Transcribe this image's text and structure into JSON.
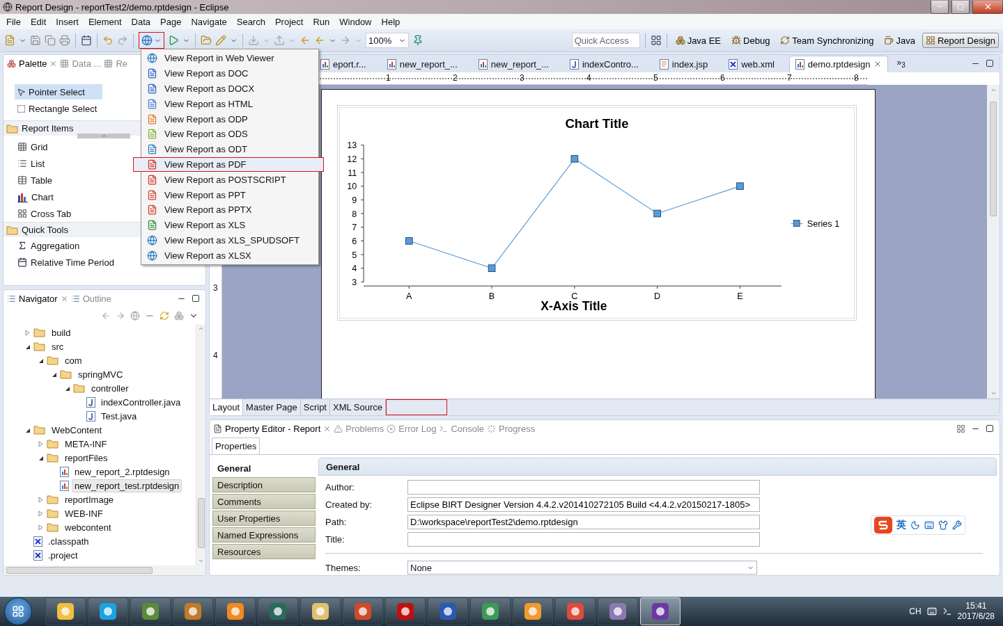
{
  "window": {
    "title": "Report Design - reportTest2/demo.rptdesign - Eclipse"
  },
  "menu_bar": [
    "File",
    "Edit",
    "Insert",
    "Element",
    "Data",
    "Page",
    "Navigate",
    "Search",
    "Project",
    "Run",
    "Window",
    "Help"
  ],
  "toolbar": {
    "run_report_expanded": true,
    "zoom": "100%",
    "quick_access": {
      "placeholder": "Quick Access"
    }
  },
  "perspectives": [
    {
      "label": "Java EE",
      "selected": false
    },
    {
      "label": "Debug",
      "selected": false
    },
    {
      "label": "Team Synchronizing",
      "selected": false
    },
    {
      "label": "Java",
      "selected": false
    },
    {
      "label": "Report Design",
      "selected": true
    }
  ],
  "run_menu": [
    {
      "label": "View Report in Web Viewer",
      "selected": false
    },
    {
      "label": "View Report as DOC",
      "selected": false
    },
    {
      "label": "View Report as DOCX",
      "selected": false
    },
    {
      "label": "View Report as HTML",
      "selected": false
    },
    {
      "label": "View Report as ODP",
      "selected": false
    },
    {
      "label": "View Report as ODS",
      "selected": false
    },
    {
      "label": "View Report as ODT",
      "selected": false
    },
    {
      "label": "View Report as PDF",
      "selected": true
    },
    {
      "label": "View Report as POSTSCRIPT",
      "selected": false
    },
    {
      "label": "View Report as PPT",
      "selected": false
    },
    {
      "label": "View Report as PPTX",
      "selected": false
    },
    {
      "label": "View Report as XLS",
      "selected": false
    },
    {
      "label": "View Report as XLS_SPUDSOFT",
      "selected": false
    },
    {
      "label": "View Report as XLSX",
      "selected": false
    }
  ],
  "palette": {
    "tabs": [
      {
        "label": "Palette",
        "selected": true
      },
      {
        "label": "Data ...",
        "selected": false
      },
      {
        "label": "Re",
        "selected": false
      }
    ],
    "tools": [
      {
        "label": "Pointer Select",
        "selected": true
      },
      {
        "label": "Rectangle Select",
        "selected": false
      }
    ],
    "groups": [
      {
        "label": "Report Items",
        "items": [
          "Grid",
          "List",
          "Table",
          "Chart",
          "Cross Tab"
        ]
      },
      {
        "label": "Quick Tools",
        "items": [
          "Aggregation",
          "Relative Time Period"
        ]
      }
    ]
  },
  "navigator": {
    "tabs": [
      {
        "label": "Navigator",
        "selected": true
      },
      {
        "label": "Outline",
        "selected": false
      }
    ],
    "tree": [
      {
        "label": "build",
        "kind": "folder",
        "expanded": false,
        "selected": false
      },
      {
        "label": "src",
        "kind": "folder",
        "expanded": true,
        "selected": false,
        "children": [
          {
            "label": "com",
            "kind": "folder",
            "expanded": true,
            "selected": false,
            "children": [
              {
                "label": "springMVC",
                "kind": "folder",
                "expanded": true,
                "selected": false,
                "children": [
                  {
                    "label": "controller",
                    "kind": "folder",
                    "expanded": true,
                    "selected": false,
                    "children": [
                      {
                        "label": "indexController.java",
                        "kind": "java",
                        "selected": false
                      },
                      {
                        "label": "Test.java",
                        "kind": "java",
                        "selected": false
                      }
                    ]
                  }
                ]
              }
            ]
          }
        ]
      },
      {
        "label": "WebContent",
        "kind": "folder",
        "expanded": true,
        "selected": false,
        "children": [
          {
            "label": "META-INF",
            "kind": "folder",
            "expanded": false,
            "selected": false
          },
          {
            "label": "reportFiles",
            "kind": "folder",
            "expanded": true,
            "selected": false,
            "children": [
              {
                "label": "new_report_2.rptdesign",
                "kind": "report",
                "selected": false
              },
              {
                "label": "new_report_test.rptdesign",
                "kind": "report",
                "selected": true
              }
            ]
          },
          {
            "label": "reportImage",
            "kind": "folder",
            "expanded": false,
            "selected": false
          },
          {
            "label": "WEB-INF",
            "kind": "folder",
            "expanded": false,
            "selected": false
          },
          {
            "label": "webcontent",
            "kind": "folder",
            "expanded": false,
            "selected": false
          }
        ]
      },
      {
        "label": ".classpath",
        "kind": "xml",
        "selected": false
      },
      {
        "label": ".project",
        "kind": "xml",
        "selected": false
      }
    ]
  },
  "editor": {
    "tabs": [
      {
        "label": "eport.r...",
        "kind": "report",
        "selected": false
      },
      {
        "label": "new_report_...",
        "kind": "report",
        "selected": false
      },
      {
        "label": "new_report_...",
        "kind": "report",
        "selected": false
      },
      {
        "label": "indexContro...",
        "kind": "java",
        "selected": false
      },
      {
        "label": "index.jsp",
        "kind": "jsp",
        "selected": false
      },
      {
        "label": "web.xml",
        "kind": "xml",
        "selected": false
      },
      {
        "label": "demo.rptdesign",
        "kind": "report",
        "selected": true
      }
    ],
    "overflow": "»$_{3}$",
    "ruler_labels": [
      "1",
      "2",
      "3",
      "4",
      "5",
      "6",
      "7",
      "8"
    ],
    "vertical_ruler_labels": [
      "3",
      "4"
    ],
    "chart_data": {
      "type": "line",
      "title": "Chart Title",
      "xlabel": "X-Axis Title",
      "categories": [
        "A",
        "B",
        "C",
        "D",
        "E"
      ],
      "series": [
        {
          "name": "Series 1",
          "color": "#5a9bd5",
          "marker": "square",
          "values": [
            6,
            4,
            12,
            8,
            10
          ]
        }
      ],
      "ylim": [
        3,
        13
      ],
      "yticks": [
        3,
        4,
        5,
        6,
        7,
        8,
        9,
        10,
        11,
        12,
        13
      ]
    },
    "bottom_tabs": [
      {
        "label": "Layout",
        "selected": true
      },
      {
        "label": "Master Page",
        "selected": false
      },
      {
        "label": "Script",
        "selected": false
      },
      {
        "label": "XML Source",
        "selected": false
      }
    ]
  },
  "property_editor": {
    "tabs": [
      {
        "label": "Property Editor - Report",
        "selected": true
      },
      {
        "label": "Problems",
        "selected": false
      },
      {
        "label": "Error Log",
        "selected": false
      },
      {
        "label": "Console",
        "selected": false
      },
      {
        "label": "Progress",
        "selected": false
      }
    ],
    "sub_tab": "Properties",
    "categories": [
      {
        "label": "General",
        "selected": true
      },
      {
        "label": "Description",
        "selected": false
      },
      {
        "label": "Comments",
        "selected": false
      },
      {
        "label": "User Properties",
        "selected": false
      },
      {
        "label": "Named Expressions",
        "selected": false
      },
      {
        "label": "Resources",
        "selected": false
      }
    ],
    "section_title": "General",
    "fields": [
      {
        "label": "Author:"
      },
      {
        "label": "Created by:",
        "value": "Eclipse BIRT Designer Version 4.4.2.v201410272105 Build <4.4.2.v20150217-1805>"
      },
      {
        "label": "Path:",
        "value": "D:\\workspace\\reportTest2\\demo.rptdesign"
      },
      {
        "label": "Title:"
      }
    ],
    "themes": {
      "label": "Themes:",
      "value": "None"
    }
  },
  "ime_toolbar": {
    "mode": "英"
  },
  "taskbar": {
    "apps": [
      {
        "selected": false
      },
      {
        "selected": false
      },
      {
        "selected": false
      },
      {
        "selected": false
      },
      {
        "selected": false
      },
      {
        "selected": false
      },
      {
        "selected": false
      },
      {
        "selected": false
      },
      {
        "selected": false
      },
      {
        "selected": false
      },
      {
        "selected": false
      },
      {
        "selected": false
      },
      {
        "selected": false
      },
      {
        "selected": false
      },
      {
        "selected": true
      }
    ],
    "language": "CH",
    "time": "15:41",
    "date": "2017/6/28"
  }
}
